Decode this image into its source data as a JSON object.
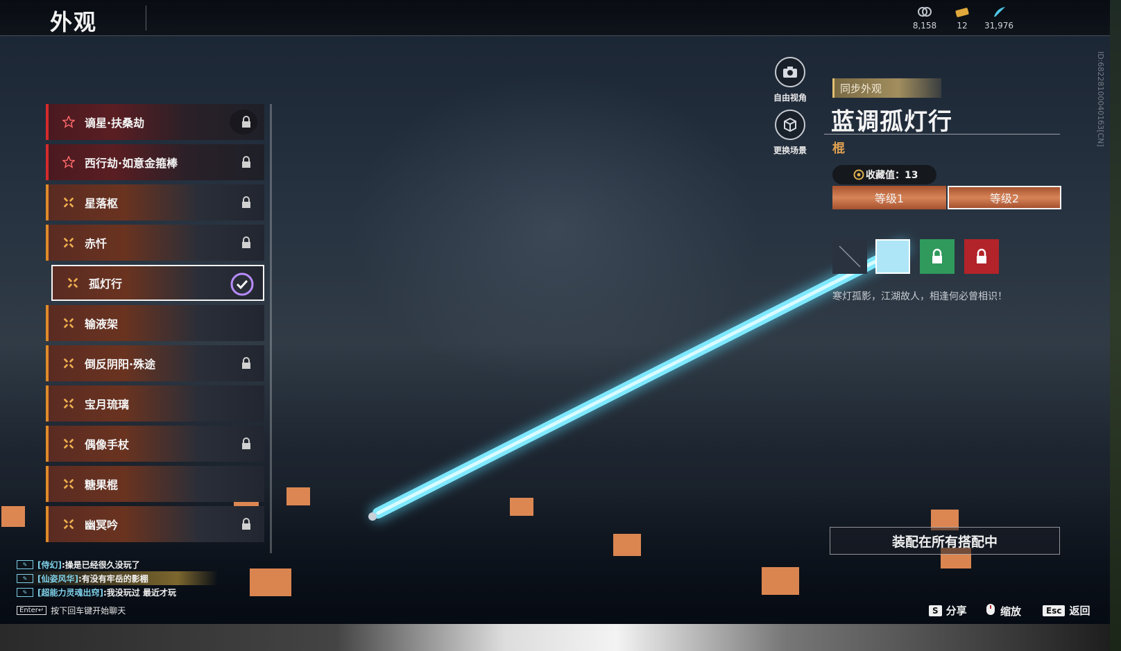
{
  "header": {
    "title": "外观",
    "currencies": [
      {
        "icon": "silver-coin-icon",
        "value": "8,158"
      },
      {
        "icon": "ticket-icon",
        "value": "12"
      },
      {
        "icon": "feather-icon",
        "value": "31,976"
      }
    ]
  },
  "side_buttons": {
    "free_view": "自由视角",
    "change_scene": "更换场景"
  },
  "skin_list": [
    {
      "label": "谪星·扶桑劫",
      "rarity": "red",
      "locked": true
    },
    {
      "label": "西行劫·如意金箍棒",
      "rarity": "red",
      "locked": true
    },
    {
      "label": "星落枢",
      "rarity": "orange",
      "locked": true
    },
    {
      "label": "赤忏",
      "rarity": "orange",
      "locked": true
    },
    {
      "label": "孤灯行",
      "rarity": "orange",
      "locked": false,
      "selected": true
    },
    {
      "label": "输液架",
      "rarity": "orange",
      "locked": false
    },
    {
      "label": "倒反阴阳·殊途",
      "rarity": "orange",
      "locked": true
    },
    {
      "label": "宝月琉璃",
      "rarity": "orange",
      "locked": false
    },
    {
      "label": "偶像手杖",
      "rarity": "orange",
      "locked": true
    },
    {
      "label": "糖果棍",
      "rarity": "orange",
      "locked": false
    },
    {
      "label": "幽冥吟",
      "rarity": "orange",
      "locked": true
    }
  ],
  "detail": {
    "sync_tag": "同步外观",
    "name": "蓝调孤灯行",
    "weapon_type": "棍",
    "collect_value": "收藏值：13",
    "level_tabs": [
      "等级1",
      "等级2"
    ],
    "active_level": 1,
    "swatches": [
      "none",
      "#aee6f7",
      "#2f9a5c",
      "#b3232a"
    ],
    "description": "寒灯孤影，江湖故人，相逢何必曾相识！",
    "equip_button": "装配在所有搭配中",
    "player_id": "ID:682281000401б3[CN]"
  },
  "chat": {
    "lines": [
      {
        "who": "[侍幻]",
        "msg": ":操是已经很久没玩了"
      },
      {
        "who": "[仙姿风华]",
        "msg": ":有没有牢岳的影棚"
      },
      {
        "who": "[超能力灵魂出窍]",
        "msg": ":我没玩过 最近才玩"
      }
    ],
    "enter_key": "Enter↵",
    "hint": "按下回车键开始聊天"
  },
  "controls": {
    "share_key": "S",
    "share": "分享",
    "zoom": "缩放",
    "back_key": "Esc",
    "back": "返回"
  },
  "colors": {
    "accent_orange": "#e08a2a",
    "accent_red": "#d22b2b",
    "staff_glow": "#5fe0ff",
    "gold_text": "#e0a050"
  }
}
